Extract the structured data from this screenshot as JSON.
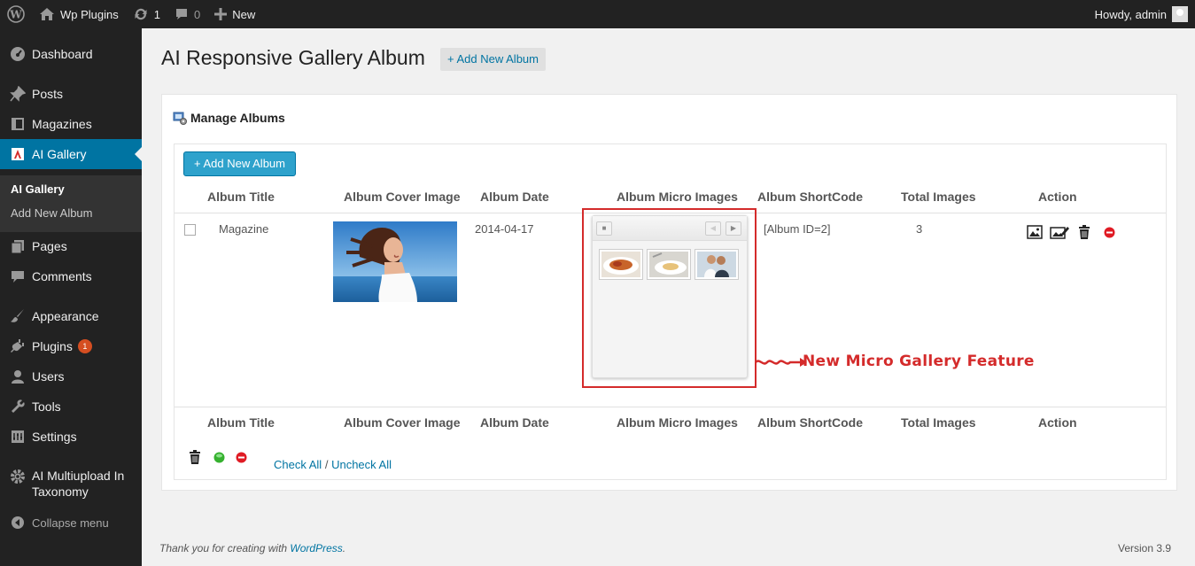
{
  "adminbar": {
    "site_name": "Wp Plugins",
    "updates_count": "1",
    "comments_count": "0",
    "new_label": "New",
    "howdy": "Howdy, admin"
  },
  "sidebar": {
    "items": [
      {
        "label": "Dashboard",
        "icon": "dashboard-icon"
      },
      {
        "label": "Posts",
        "icon": "pin-icon"
      },
      {
        "label": "Magazines",
        "icon": "page-icon"
      },
      {
        "label": "AI Gallery",
        "icon": "gallery-icon"
      },
      {
        "label": "Pages",
        "icon": "pages-icon"
      },
      {
        "label": "Comments",
        "icon": "comment-icon"
      },
      {
        "label": "Appearance",
        "icon": "brush-icon"
      },
      {
        "label": "Plugins",
        "icon": "plug-icon",
        "badge": "1"
      },
      {
        "label": "Users",
        "icon": "user-icon"
      },
      {
        "label": "Tools",
        "icon": "wrench-icon"
      },
      {
        "label": "Settings",
        "icon": "settings-icon"
      },
      {
        "label_line1": "AI Multiupload In",
        "label_line2": "Taxonomy",
        "icon": "gear-icon"
      }
    ],
    "submenu": [
      "AI Gallery",
      "Add New Album"
    ],
    "collapse": "Collapse menu"
  },
  "page": {
    "title": "AI Responsive Gallery Album",
    "title_button": "+ Add New Album",
    "panel_title": "Manage Albums",
    "add_button": "+ Add New Album"
  },
  "table": {
    "columns": [
      "Album Title",
      "Album Cover Image",
      "Album Date",
      "Album Micro Images",
      "Album ShortCode",
      "Total Images",
      "Action"
    ],
    "rows": [
      {
        "title": "Magazine",
        "date": "2014-04-17",
        "shortcode": "[Album ID=2]",
        "total": "3"
      }
    ]
  },
  "annotation": "New Micro Gallery Feature",
  "bulk": {
    "check_all": "Check All",
    "separator": "/",
    "uncheck_all": "Uncheck All"
  },
  "footer": {
    "thanks": "Thank you for creating with ",
    "wp_link": "WordPress",
    "version": "Version 3.9"
  },
  "colors": {
    "admin_bar": "#222222",
    "active_menu": "#0074a2",
    "button": "#2ea2cc",
    "annotation": "#d42b2b"
  }
}
